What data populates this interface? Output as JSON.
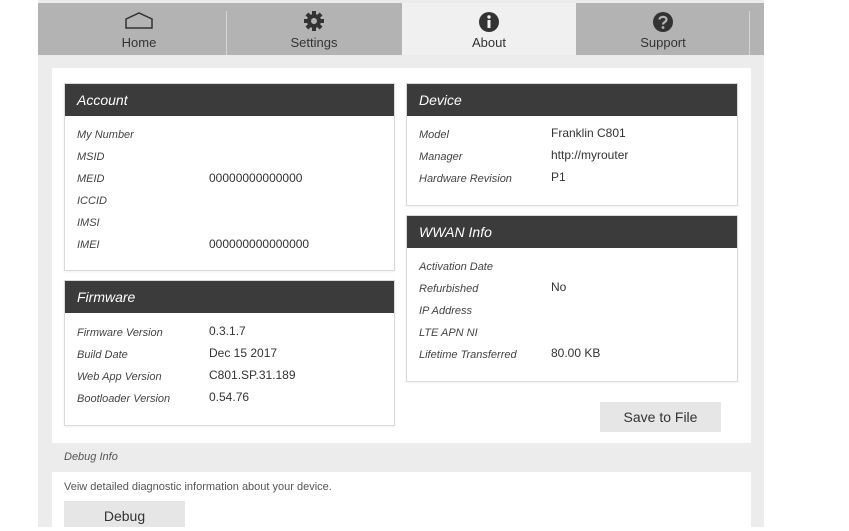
{
  "tabs": [
    {
      "label": "Home",
      "icon": "home-icon"
    },
    {
      "label": "Settings",
      "icon": "gear-icon"
    },
    {
      "label": "About",
      "icon": "info-icon"
    },
    {
      "label": "Support",
      "icon": "help-icon"
    }
  ],
  "active_tab": "About",
  "account": {
    "title": "Account",
    "rows": [
      {
        "label": "My Number",
        "value": ""
      },
      {
        "label": "MSID",
        "value": ""
      },
      {
        "label": "MEID",
        "value": "00000000000000"
      },
      {
        "label": "ICCID",
        "value": ""
      },
      {
        "label": "IMSI",
        "value": ""
      },
      {
        "label": "IMEI",
        "value": "000000000000000"
      }
    ]
  },
  "firmware": {
    "title": "Firmware",
    "rows": [
      {
        "label": "Firmware Version",
        "value": "0.3.1.7"
      },
      {
        "label": "Build Date",
        "value": "Dec 15 2017"
      },
      {
        "label": "Web App Version",
        "value": "C801.SP.31.189"
      },
      {
        "label": "Bootloader Version",
        "value": "0.54.76"
      }
    ]
  },
  "device": {
    "title": "Device",
    "rows": [
      {
        "label": "Model",
        "value": "Franklin C801"
      },
      {
        "label": "Manager",
        "value": "http://myrouter"
      },
      {
        "label": "Hardware Revision",
        "value": "P1"
      }
    ]
  },
  "wwan": {
    "title": "WWAN Info",
    "rows": [
      {
        "label": "Activation Date",
        "value": ""
      },
      {
        "label": "Refurbished",
        "value": "No"
      },
      {
        "label": "IP Address",
        "value": ""
      },
      {
        "label": "LTE APN NI",
        "value": ""
      },
      {
        "label": "Lifetime Transferred",
        "value": "80.00 KB"
      }
    ]
  },
  "save_button": "Save to File",
  "debug": {
    "title": "Debug Info",
    "description": "Veiw detailed diagnostic information about your device.",
    "button": "Debug"
  },
  "colors": {
    "panel_header": "#3b3b3b",
    "tab_bar": "#b3b3b3",
    "tab_active": "#f0f0f0"
  }
}
